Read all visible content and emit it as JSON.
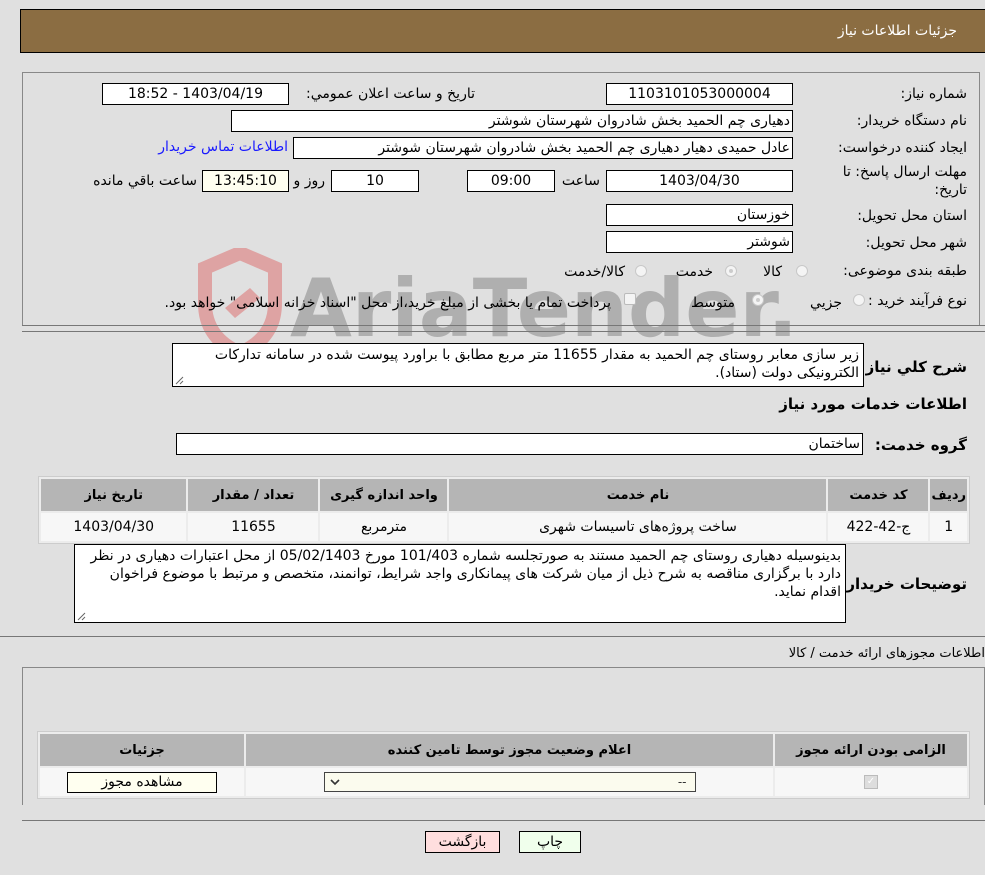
{
  "header": {
    "title": "جزئيات اطلاعات نياز"
  },
  "form": {
    "need_number": {
      "label": "شماره نیاز:",
      "value": "1103101053000004"
    },
    "announce_datetime": {
      "label": "تاریخ و ساعت اعلان عمومي:",
      "value": "1403/04/19 - 18:52"
    },
    "buyer_org": {
      "label": "نام دستگاه خریدار:",
      "value": "دهیاری چم الحمید بخش شادروان شهرستان شوشتر"
    },
    "requester": {
      "label": "ایجاد کننده درخواست:",
      "value": "عادل حمیدی دهیار دهیاری چم الحمید بخش شادروان شهرستان شوشتر"
    },
    "contact_link": "اطلاعات تماس خریدار",
    "deadline": {
      "label_line1": "مهلت ارسال پاسخ: تا",
      "label_line2": "تاریخ:",
      "date": "1403/04/30",
      "time_label": "ساعت",
      "time": "09:00",
      "days": "10",
      "days_label": "روز و",
      "remaining": "13:45:10",
      "remaining_label": "ساعت باقي مانده"
    },
    "province": {
      "label": "استان محل تحویل:",
      "value": "خوزستان"
    },
    "city": {
      "label": "شهر محل تحویل:",
      "value": "شوشتر"
    },
    "category": {
      "label": "طبقه بندی موضوعی:",
      "options": [
        "کالا",
        "خدمت",
        "کالا/خدمت"
      ],
      "selected": "خدمت"
    },
    "process_type": {
      "label": "نوع فرآیند خرید :",
      "options": [
        "جزيي",
        "متوسط"
      ],
      "selected": "متوسط",
      "treasury_note": "پرداخت تمام یا بخشی از مبلغ خرید،از محل \"اسناد خزانه اسلامی\" خواهد بود."
    }
  },
  "description": {
    "label": "شرح کلي نياز:",
    "value": "زیر سازی معابر  روستای چم الحمید به مقدار 11655 متر مربع مطابق با براورد پیوست شده در سامانه تدارکات الکترونیکی دولت (ستاد)."
  },
  "services_section": {
    "title": "اطلاعات خدمات مورد نياز",
    "group_label": "گروه خدمت:",
    "group_value": "ساختمان",
    "table": {
      "headers": [
        "ردیف",
        "کد خدمت",
        "نام خدمت",
        "واحد اندازه گیری",
        "تعداد / مقدار",
        "تاریخ نیاز"
      ],
      "rows": [
        [
          "1",
          "ج-42-422",
          "ساخت پروژه‌های تاسیسات شهری",
          "مترمربع",
          "11655",
          "1403/04/30"
        ]
      ]
    }
  },
  "buyer_notes": {
    "label": "توضیحات خریدار:",
    "value": "بدینوسیله دهیاری روستای چم الحمید مستند به صورتجلسه شماره 101/403 مورخ 05/02/1403 از محل اعتبارات دهیاری در نظر دارد با برگزاری مناقصه به شرح ذیل از میان شرکت های پیمانکاری واجد شرایط، توانمند، متخصص و مرتبط با موضوع فراخوان اقدام نماید."
  },
  "permits": {
    "title": "اطلاعات مجوزهای ارائه خدمت / کالا",
    "headers": [
      "الزامی بودن ارائه مجوز",
      "اعلام وضعیت مجوز توسط تامین کننده",
      "جزئیات"
    ],
    "row": {
      "required_checked": true,
      "status_value": "--",
      "view_button": "مشاهده مجوز"
    }
  },
  "footer": {
    "print_button": "چاپ",
    "back_button": "بازگشت"
  },
  "watermark": {
    "text": "AriaTender.neT"
  }
}
